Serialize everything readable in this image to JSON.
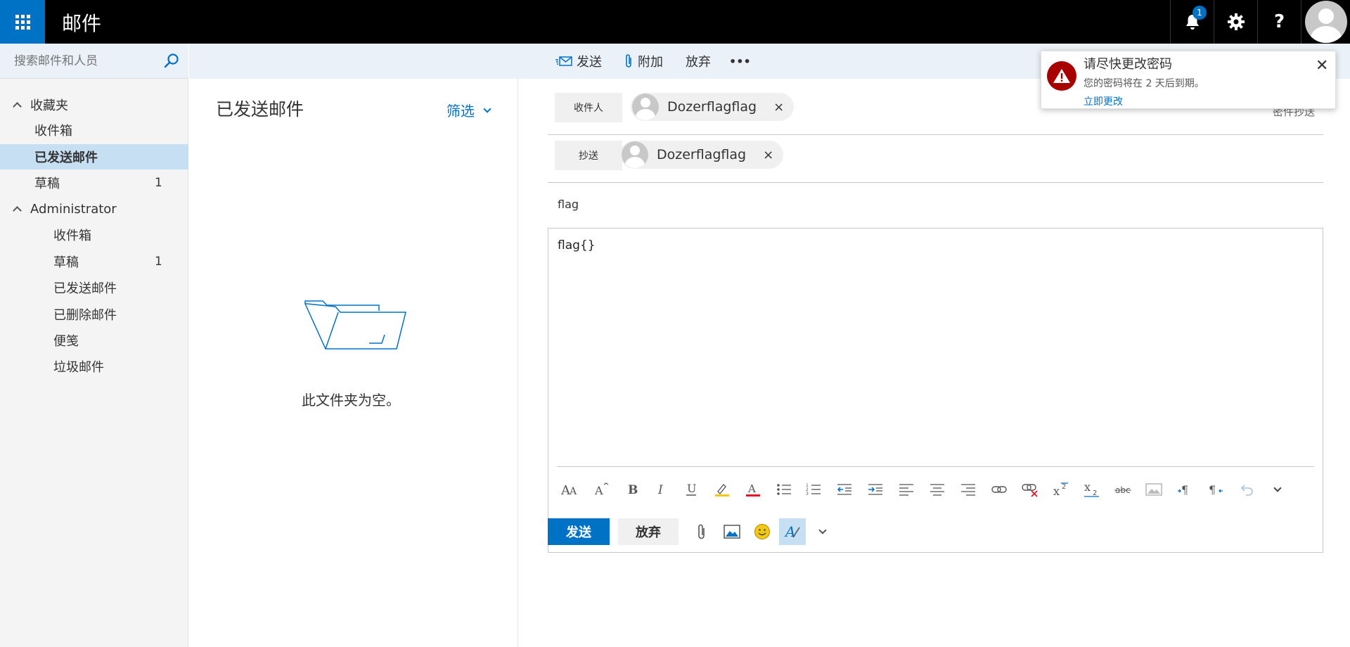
{
  "app": {
    "title": "邮件"
  },
  "topbar": {
    "notification_count": "1",
    "help_glyph": "?"
  },
  "search": {
    "placeholder": "搜索邮件和人员"
  },
  "sidebar": {
    "favorites_label": "收藏夹",
    "favorites": [
      {
        "label": "收件箱",
        "count": ""
      },
      {
        "label": "已发送邮件",
        "count": ""
      },
      {
        "label": "草稿",
        "count": "1"
      }
    ],
    "account_label": "Administrator",
    "account_folders": [
      {
        "label": "收件箱",
        "count": ""
      },
      {
        "label": "草稿",
        "count": "1"
      },
      {
        "label": "已发送邮件",
        "count": ""
      },
      {
        "label": "已删除邮件",
        "count": ""
      },
      {
        "label": "便笺",
        "count": ""
      },
      {
        "label": "垃圾邮件",
        "count": ""
      }
    ]
  },
  "list": {
    "title": "已发送邮件",
    "filter_label": "筛选",
    "empty_text": "此文件夹为空。"
  },
  "commands": {
    "send": "发送",
    "attach": "附加",
    "discard": "放弃",
    "more": "•••"
  },
  "compose": {
    "to_label": "收件人",
    "to": [
      {
        "name": "Dozerflagflag"
      }
    ],
    "cc_label": "抄送",
    "cc": [
      {
        "name": "Dozerflagflag"
      }
    ],
    "bcc_label": "密件抄送",
    "subject": "flag",
    "body": "flag{}",
    "send_label": "发送",
    "discard_label": "放弃",
    "remove_glyph": "×"
  },
  "toast": {
    "title": "请尽快更改密码",
    "body": "您的密码将在 2 天后到期。",
    "link": "立即更改",
    "close_glyph": "✕"
  },
  "colors": {
    "accent": "#0072c6",
    "topbar": "#000000",
    "selected": "#c7dff3",
    "alert": "#a80000"
  }
}
